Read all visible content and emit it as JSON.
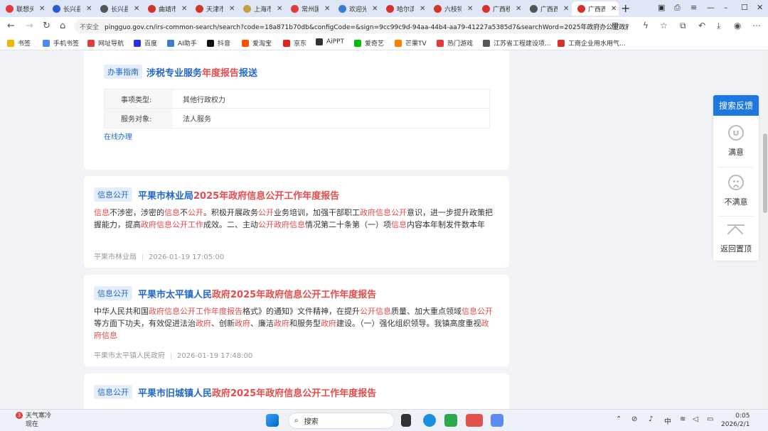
{
  "browser": {
    "tabs": [
      {
        "label": "联想头",
        "color": "#e23b3b"
      },
      {
        "label": "长兴县",
        "color": "#2a5bd7"
      },
      {
        "label": "长兴县",
        "color": "#555555"
      },
      {
        "label": "曲靖市",
        "color": "#d4322c"
      },
      {
        "label": "天津市",
        "color": "#d4322c"
      },
      {
        "label": "上海市",
        "color": "#c8a040"
      },
      {
        "label": "常州国",
        "color": "#e23b3b"
      },
      {
        "label": "欢迎光",
        "color": "#3a7bd5"
      },
      {
        "label": "哈尔滨",
        "color": "#d4322c"
      },
      {
        "label": "六枝特",
        "color": "#d4322c"
      },
      {
        "label": "广西移",
        "color": "#d4322c"
      },
      {
        "label": "广西西",
        "color": "#555555"
      },
      {
        "label": "广西西",
        "color": "#d4322c"
      }
    ],
    "new_tab": "+",
    "not_secure": "不安全",
    "url": "pingguo.gov.cn/irs-common-search/search?code=18a871b70db&configCode=&sign=9cc99c9d-94aa-44b4-aa79-41227a5385d7&searchWord=2025年政府办公室政府信息公...",
    "bookmarks": [
      {
        "label": "书签",
        "color": "#f2b400"
      },
      {
        "label": "手机书签",
        "color": "#4a8af4"
      },
      {
        "label": "网址导航",
        "color": "#e23b3b"
      },
      {
        "label": "百度",
        "color": "#2932e1"
      },
      {
        "label": "AI助手",
        "color": "#3a7bd5"
      },
      {
        "label": "抖音",
        "color": "#111111"
      },
      {
        "label": "爱淘宝",
        "color": "#ff5000"
      },
      {
        "label": "京东",
        "color": "#e1251b"
      },
      {
        "label": "AiPPT",
        "color": "#333333"
      },
      {
        "label": "爱奇艺",
        "color": "#00be06"
      },
      {
        "label": "芒果TV",
        "color": "#ff7e00"
      },
      {
        "label": "热门游戏",
        "color": "#e23b3b"
      },
      {
        "label": "江苏省工程建设项...",
        "color": "#555555"
      },
      {
        "label": "工商企业用水用气...",
        "color": "#d4322c"
      }
    ]
  },
  "results": [
    {
      "tag": "办事指南",
      "title_parts": [
        "涉税专业服务",
        "年度报告",
        "报送"
      ],
      "rows": [
        {
          "key": "事项类型:",
          "value": "其他行政权力"
        },
        {
          "key": "服务对象:",
          "value": "法人服务"
        }
      ],
      "action": "在线办理"
    },
    {
      "tag": "信息公开",
      "title_parts": [
        "平果市林业局",
        "2025年政府信息公开工作年度报告"
      ],
      "body_parts": [
        "信息",
        "不涉密，涉密的",
        "信息",
        "不",
        "公开",
        "。积极开展政务",
        "公开",
        "业务培训，加强干部职工",
        "政府信息公开",
        "意识，进一步提升政策把握能力，提高",
        "政府信息公开工作",
        "成效。二、主动",
        "公开政府信息",
        "情况第二十条第（一）项",
        "信息",
        "内容本年制发件数本年"
      ],
      "source": "平果市林业局",
      "date": "2026-01-19 17:05:00"
    },
    {
      "tag": "信息公开",
      "title_parts": [
        "平果市太平镇人民",
        "政府2025年政府信息公开工作年度报告"
      ],
      "body_parts": [
        "中华人民共和国",
        "政府信息公开工作年度报告",
        "格式》的通知》文件精神，在提升",
        "公开信息",
        "质量、加大重点领域",
        "信息公开",
        "等方面下功夫，有效促进法治",
        "政府",
        "、创新",
        "政府",
        "、廉洁",
        "政府",
        "和服务型",
        "政府",
        "建设。（一）强化组织领导。我镇高度重视",
        "政府信息",
        ""
      ],
      "source": "平果市太平镇人民政府",
      "date": "2026-01-19 17:48:00"
    },
    {
      "tag": "信息公开",
      "title_parts": [
        "平果市旧城镇人民",
        "政府2025年政府信息公开工作年度报告"
      ]
    }
  ],
  "feedback": {
    "title": "搜索反馈",
    "satisfied": "满意",
    "unsatisfied": "不满意",
    "back_top": "返回置顶"
  },
  "taskbar": {
    "weather_title": "天气寒冷",
    "weather_sub": "现在",
    "weather_badge": "3",
    "search": "搜索",
    "ime": "中",
    "time": "0:05",
    "date": "2026/2/1"
  }
}
